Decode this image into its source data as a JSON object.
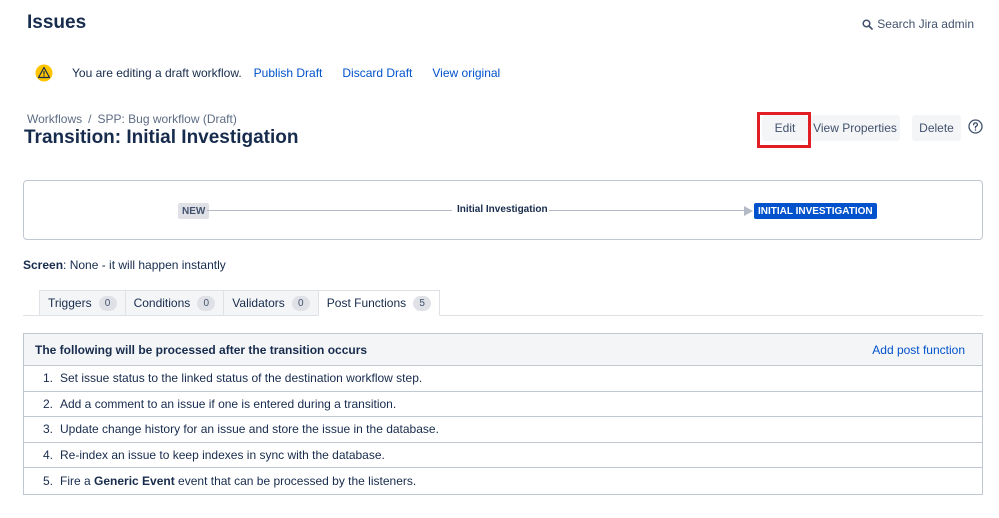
{
  "header": {
    "title": "Issues",
    "search_label": "Search Jira admin"
  },
  "draft_bar": {
    "message": "You are editing a draft workflow.",
    "publish": "Publish Draft",
    "discard": "Discard Draft",
    "view_original": "View original"
  },
  "breadcrumb": {
    "root": "Workflows",
    "separator": "/",
    "current": "SPP: Bug workflow (Draft)"
  },
  "transition": {
    "title": "Transition: Initial Investigation"
  },
  "actions": {
    "edit": "Edit",
    "view_properties": "View Properties",
    "delete": "Delete"
  },
  "diagram": {
    "from_status": "NEW",
    "transition_name": "Initial Investigation",
    "to_status": "INITIAL INVESTIGATION"
  },
  "screen": {
    "label": "Screen",
    "value": ": None - it will happen instantly"
  },
  "tabs": [
    {
      "label": "Triggers",
      "count": "0"
    },
    {
      "label": "Conditions",
      "count": "0"
    },
    {
      "label": "Validators",
      "count": "0"
    },
    {
      "label": "Post Functions",
      "count": "5"
    }
  ],
  "post_functions": {
    "header": "The following will be processed after the transition occurs",
    "add_link": "Add post function",
    "items": [
      {
        "num": "1.",
        "text": "Set issue status to the linked status of the destination workflow step."
      },
      {
        "num": "2.",
        "text": "Add a comment to an issue if one is entered during a transition."
      },
      {
        "num": "3.",
        "text": "Update change history for an issue and store the issue in the database."
      },
      {
        "num": "4.",
        "text": "Re-index an issue to keep indexes in sync with the database."
      },
      {
        "num": "5.",
        "text_before": "Fire a ",
        "text_bold": "Generic Event",
        "text_after": " event that can be processed by the listeners."
      }
    ]
  },
  "colors": {
    "link": "#0052cc",
    "warning": "#ffc400",
    "highlight_box": "#e01e24",
    "status_target_bg": "#0052cc"
  }
}
